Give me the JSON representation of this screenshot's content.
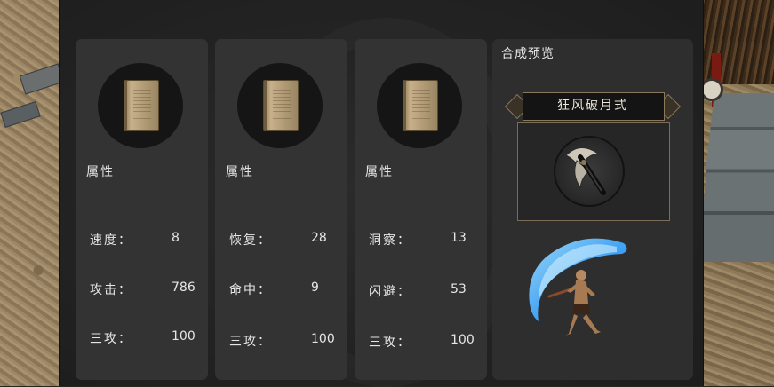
{
  "cards": [
    {
      "attr_title": "属性",
      "stats": [
        {
          "label": "速度：",
          "value": "8"
        },
        {
          "label": "攻击：",
          "value": "786"
        },
        {
          "label": "三攻：",
          "value": "100"
        }
      ]
    },
    {
      "attr_title": "属性",
      "stats": [
        {
          "label": "恢复：",
          "value": "28"
        },
        {
          "label": "命中：",
          "value": "9"
        },
        {
          "label": "三攻：",
          "value": "100"
        }
      ]
    },
    {
      "attr_title": "属性",
      "stats": [
        {
          "label": "洞察：",
          "value": "13"
        },
        {
          "label": "闪避：",
          "value": "53"
        },
        {
          "label": "三攻：",
          "value": "100"
        }
      ]
    }
  ],
  "preview": {
    "title": "合成预览",
    "skill_name": "狂风破月式"
  },
  "colors": {
    "panel_bg": "#232323",
    "card_bg": "#333333",
    "frame_gold": "#8a785c",
    "slash_blue": "#3fa6ff"
  },
  "icons": {
    "book": "skill-book-icon",
    "skill": "crescent-axe-icon",
    "figure": "monk-fighter-figure"
  }
}
